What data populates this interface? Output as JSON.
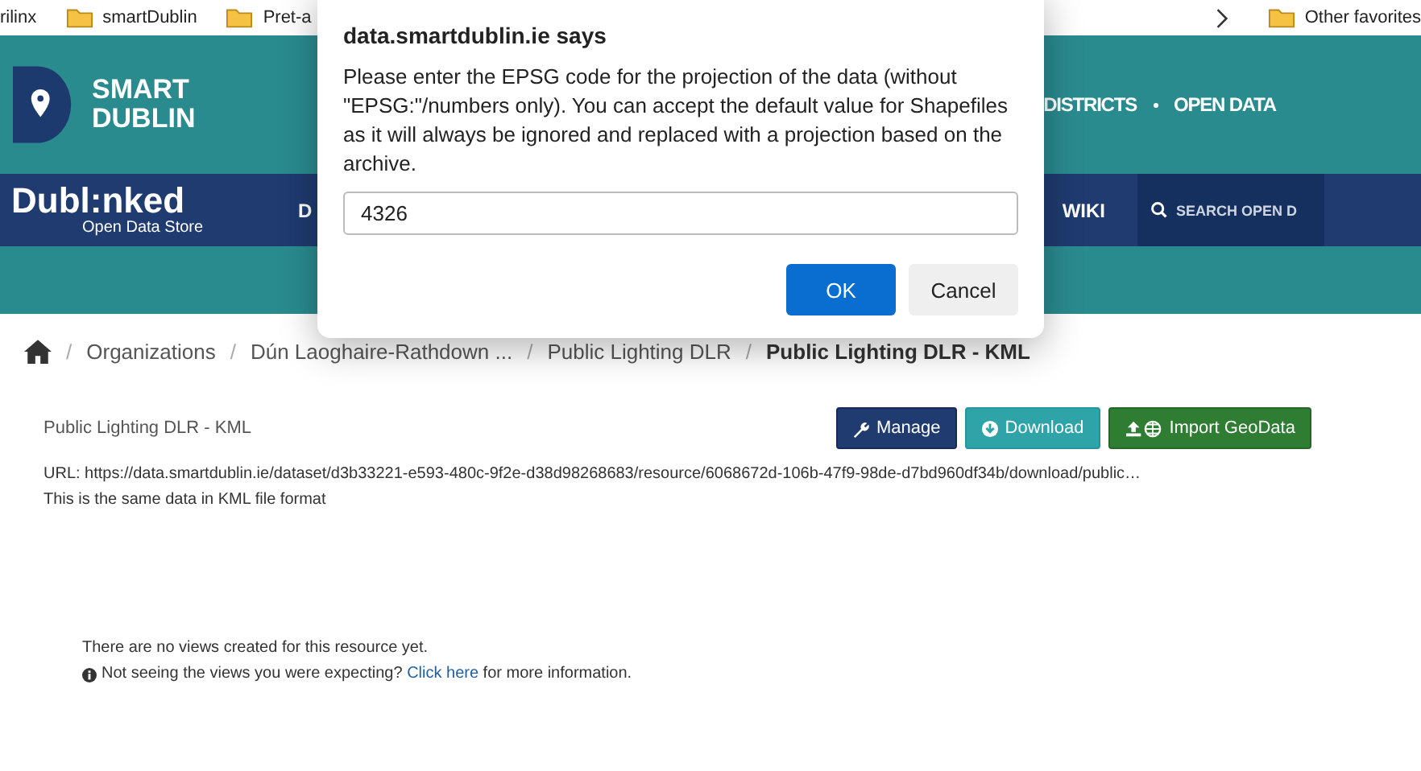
{
  "bookmarks": {
    "items": [
      {
        "label": "rilinx",
        "kind": "link"
      },
      {
        "label": "smartDublin",
        "kind": "folder"
      },
      {
        "label": "Pret-a",
        "kind": "folder"
      }
    ],
    "other": "Other favorites"
  },
  "header": {
    "logo_lines": [
      "SMART",
      "DUBLIN"
    ],
    "nav": [
      "DISTRICTS",
      "OPEN DATA"
    ]
  },
  "navbar": {
    "logo": "Dubl:nked",
    "logo_sub": "Open Data Store",
    "items": [
      "D",
      "WIKI"
    ],
    "search_placeholder": "SEARCH OPEN D"
  },
  "breadcrumb_separator": "/",
  "breadcrumb": [
    {
      "label": "Organizations",
      "current": false
    },
    {
      "label": "Dún Laoghaire-Rathdown ...",
      "current": false
    },
    {
      "label": "Public Lighting DLR",
      "current": false
    },
    {
      "label": "Public Lighting DLR - KML",
      "current": true
    }
  ],
  "resource": {
    "title": "Public Lighting DLR - KML",
    "buttons": [
      {
        "label": "Manage",
        "kind": "manage"
      },
      {
        "label": "Download",
        "kind": "download"
      },
      {
        "label": "Import GeoData",
        "kind": "import"
      }
    ],
    "url": "URL: https://data.smartdublin.ie/dataset/d3b33221-e593-480c-9f2e-d38d98268683/resource/6068672d-106b-47f9-98de-d7bd960df34b/download/public…",
    "description": "This is the same data in KML file format"
  },
  "views": {
    "message": "There are no views created for this resource yet.",
    "info_before": "Not seeing the views you were expecting? ",
    "info_link": "Click here",
    "info_after": " for more information."
  },
  "dialog": {
    "title": "data.smartdublin.ie says",
    "message": "Please enter the EPSG code for the projection of the data (without \"EPSG:\"/numbers only). You can accept the default value for Shapefiles as it will always be ignored and replaced with a projection based on the archive.",
    "value": "4326",
    "buttons": [
      {
        "label": "OK",
        "kind": "primary"
      },
      {
        "label": "Cancel",
        "kind": "secondary"
      }
    ]
  }
}
